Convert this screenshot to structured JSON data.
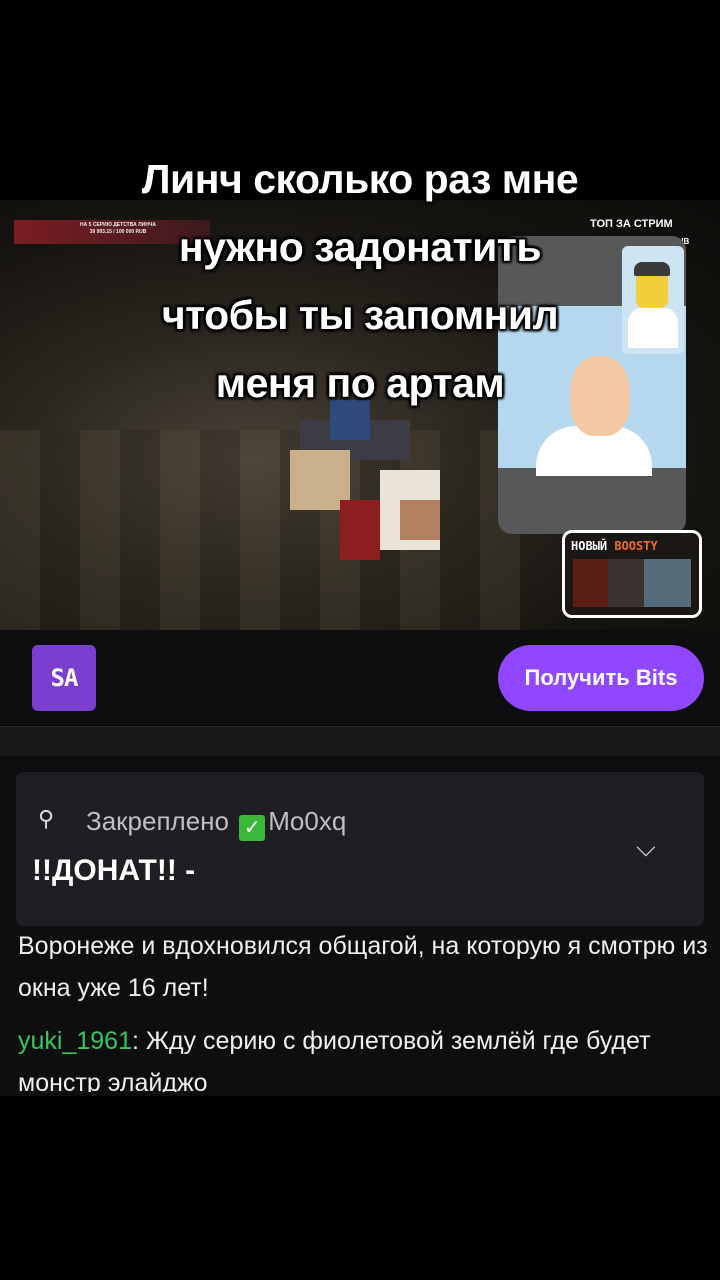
{
  "overlay_caption": {
    "line1": "Линч сколько раз мне",
    "line2": "нужно задонатить",
    "line3": "чтобы ты запомнил",
    "line4": "меня по артам"
  },
  "stream": {
    "donate_goal_title": "НА 5 СЕРИЮ ДЕТСТВА ЛИНЧА",
    "donate_goal_progress": "39 993.15 / 100 000 RUB",
    "top_label": "ТОП ЗА СТРИМ",
    "top_sub": "RUB",
    "boosty_label_1": "НОВЫЙ",
    "boosty_label_2": "BOOSTY"
  },
  "channel": {
    "logo_text": "SA",
    "bits_button": "Получить Bits"
  },
  "chat": {
    "pinned_label": "Закреплено",
    "pinned_by": "Mo0xq",
    "pinned_message": "!!ДОНАТ!! -",
    "messages": [
      {
        "text": "Воронеже и вдохновился общагой, на которую я смотрю из окна уже 16 лет!"
      },
      {
        "username": "yuki_1961",
        "text": "Жду серию с фиолетовой землёй где будет монстр элайджо"
      }
    ]
  },
  "colors": {
    "accent": "#9147ff",
    "username": "#34c759"
  }
}
